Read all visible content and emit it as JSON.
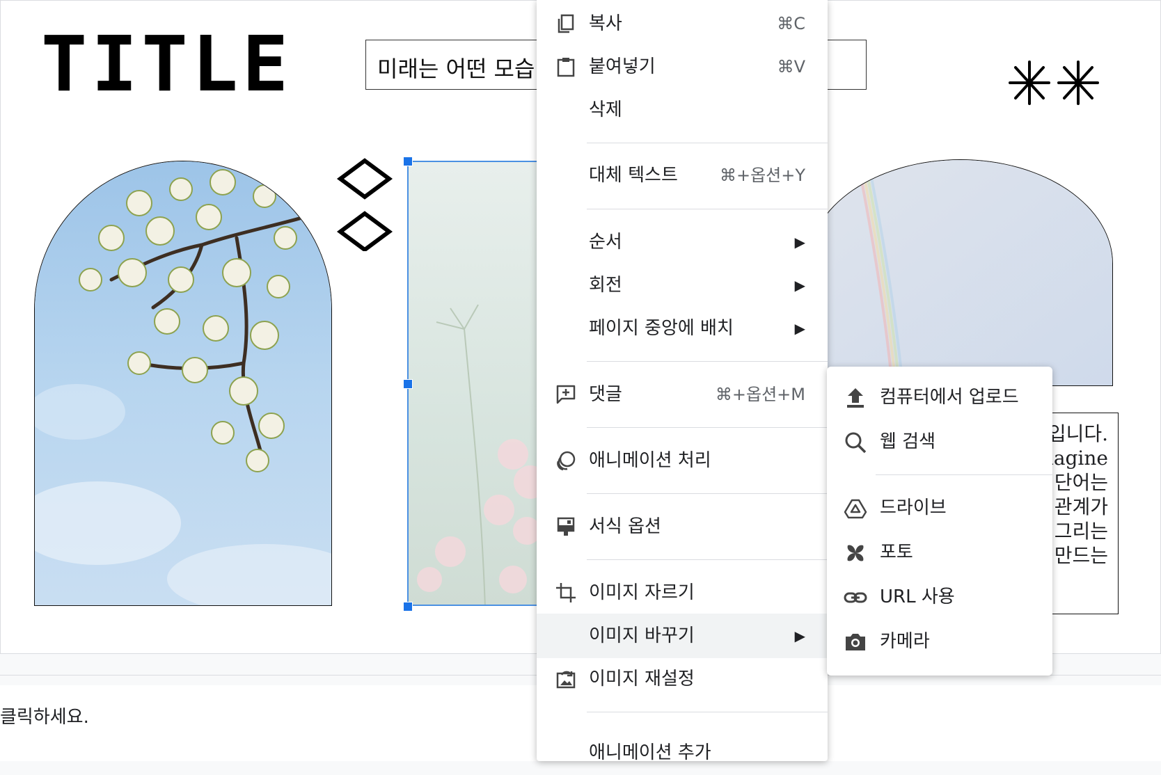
{
  "slide": {
    "title": "TITLE",
    "subtitle": "미래는 어떤 모습",
    "body_lines": [
      "입니다.",
      "imagine",
      "단어는",
      "관계가",
      "그리는",
      "만드는"
    ]
  },
  "context_menu": {
    "copy": {
      "label": "복사",
      "shortcut": "⌘C",
      "icon": "copy-icon"
    },
    "paste": {
      "label": "붙여넣기",
      "shortcut": "⌘V",
      "icon": "clipboard-icon"
    },
    "delete": {
      "label": "삭제"
    },
    "alt_text": {
      "label": "대체 텍스트",
      "shortcut": "⌘+옵션+Y"
    },
    "order": {
      "label": "순서"
    },
    "rotate": {
      "label": "회전"
    },
    "center_on_page": {
      "label": "페이지 중앙에 배치"
    },
    "comment": {
      "label": "댓글",
      "shortcut": "⌘+옵션+M",
      "icon": "add-comment-icon"
    },
    "animate": {
      "label": "애니메이션 처리",
      "icon": "animation-icon"
    },
    "format_options": {
      "label": "서식 옵션",
      "icon": "format-options-icon"
    },
    "crop_image": {
      "label": "이미지 자르기",
      "icon": "crop-icon"
    },
    "replace_image": {
      "label": "이미지 바꾸기"
    },
    "reset_image": {
      "label": "이미지 재설정",
      "icon": "reset-image-icon"
    },
    "partial_item": {
      "label": "애니메이션 추가"
    }
  },
  "replace_submenu": {
    "upload": {
      "label": "컴퓨터에서 업로드",
      "icon": "upload-icon"
    },
    "search_web": {
      "label": "웹 검색",
      "icon": "search-icon"
    },
    "drive": {
      "label": "드라이브",
      "icon": "drive-icon"
    },
    "photos": {
      "label": "포토",
      "icon": "photos-icon"
    },
    "by_url": {
      "label": "URL 사용",
      "icon": "link-icon"
    },
    "camera": {
      "label": "카메라",
      "icon": "camera-icon"
    }
  },
  "notes": {
    "text": "클릭하세요."
  },
  "colors": {
    "selection": "#1a73e8",
    "menu_highlight": "#f1f3f4"
  }
}
